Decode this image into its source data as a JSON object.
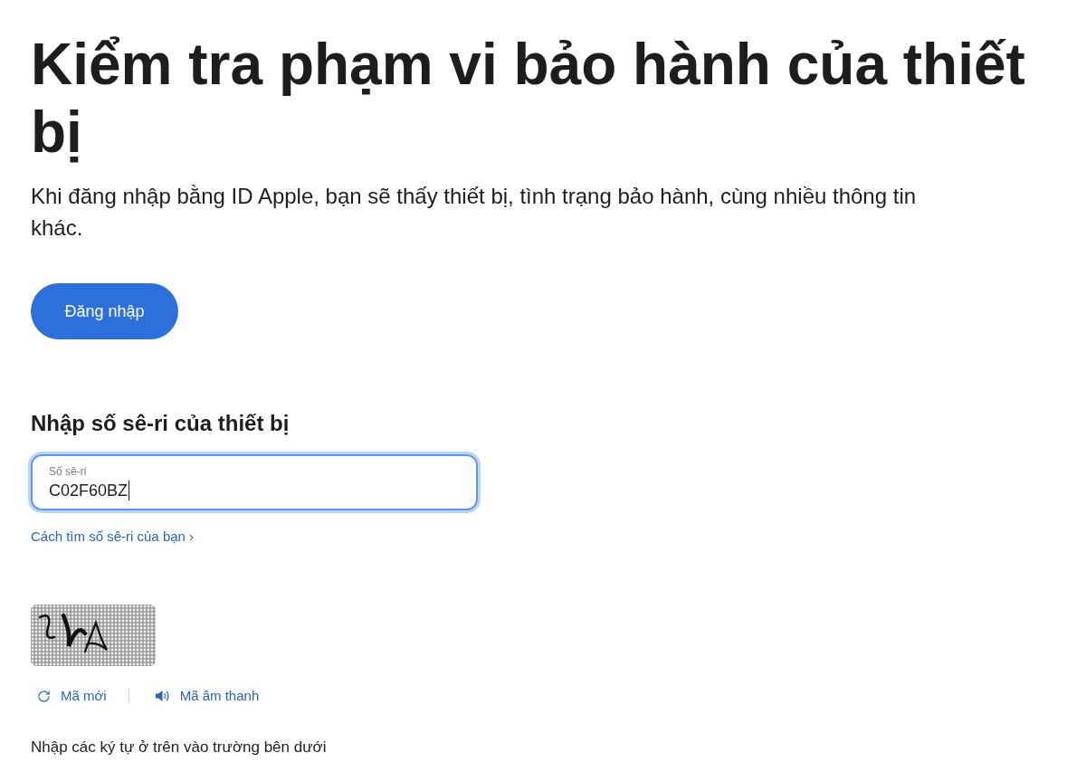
{
  "heading": "Kiểm tra phạm vi bảo hành của thiết bị",
  "intro": "Khi đăng nhập bằng ID Apple, bạn sẽ thấy thiết bị, tình trạng bảo hành, cùng nhiều thông tin khác.",
  "sign_in_button": "Đăng nhập",
  "serial_section": {
    "title": "Nhập số sê-ri của thiết bị",
    "field": {
      "label": "Số sê-ri",
      "value": "C02F60BZ",
      "focused": true
    },
    "help_link": "Cách tìm số sê-ri của bạn ›"
  },
  "captcha": {
    "actions": [
      {
        "kind": "refresh",
        "label": "Mã mới"
      },
      {
        "kind": "audio",
        "label": "Mã âm thanh"
      }
    ],
    "instruction": "Nhập các ký tự ở trên vào trường bên dưới"
  }
}
